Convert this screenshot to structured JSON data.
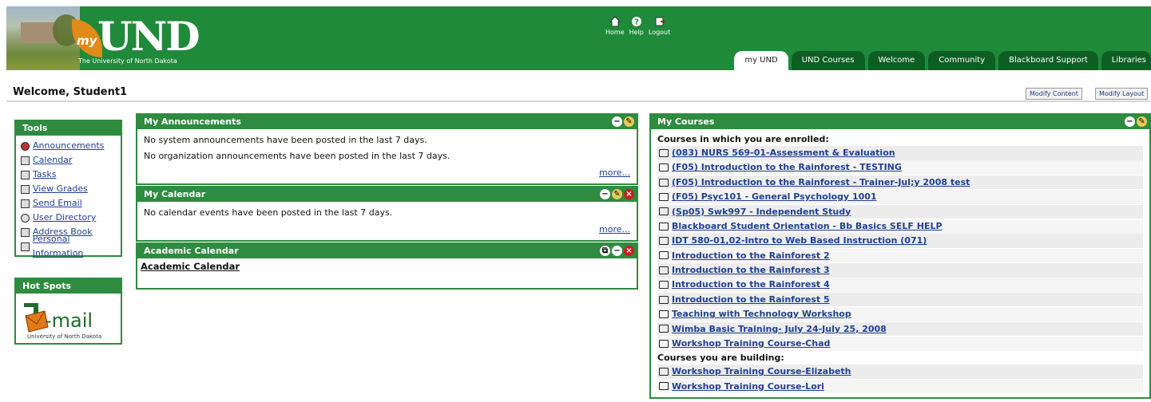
{
  "header": {
    "logo_text": "myUND",
    "logo_tagline": "The University of North Dakota",
    "topnav": [
      {
        "label": "Home",
        "icon": "home-icon"
      },
      {
        "label": "Help",
        "icon": "help-icon"
      },
      {
        "label": "Logout",
        "icon": "logout-icon"
      }
    ],
    "tabs": [
      "my UND",
      "UND Courses",
      "Welcome",
      "Community",
      "Blackboard Support",
      "Libraries"
    ],
    "active_tab": "my UND"
  },
  "welcome": {
    "text": "Welcome, Student1",
    "modify_content": "Modify Content",
    "modify_layout": "Modify Layout"
  },
  "tools": {
    "title": "Tools",
    "items": [
      {
        "label": "Announcements",
        "icon": "announcements-icon"
      },
      {
        "label": "Calendar",
        "icon": "calendar-icon"
      },
      {
        "label": "Tasks",
        "icon": "tasks-icon"
      },
      {
        "label": "View Grades",
        "icon": "grades-icon"
      },
      {
        "label": "Send Email",
        "icon": "email-icon"
      },
      {
        "label": "User Directory",
        "icon": "user-directory-icon"
      },
      {
        "label": "Address Book",
        "icon": "address-book-icon"
      },
      {
        "label": "Personal Information",
        "icon": "personal-info-icon"
      }
    ]
  },
  "hotspots": {
    "title": "Hot Spots",
    "umail_text": "-mail",
    "umail_sub": "University of North Dakota"
  },
  "announcements": {
    "title": "My Announcements",
    "lines": [
      "No system announcements have been posted in the last 7 days.",
      "No organization announcements have been posted in the last 7 days."
    ],
    "more": "more..."
  },
  "calendar": {
    "title": "My Calendar",
    "line": "No calendar events have been posted in the last 7 days.",
    "more": "more..."
  },
  "academic": {
    "title": "Academic Calendar",
    "link": "Academic Calendar"
  },
  "courses": {
    "title": "My Courses",
    "enrolled_heading": "Courses in which you are enrolled:",
    "enrolled": [
      "(083) NURS 569-01-Assessment & Evaluation",
      "(F05) Introduction to the Rainforest - TESTING",
      "(F05) Introduction to the Rainforest - Trainer-Jul;y 2008 test",
      "(F05) Psyc101 - General Psychology 1001",
      "(Sp05) Swk997 - Independent Study",
      "Blackboard Student Orientation - Bb Basics SELF HELP",
      "IDT 580-01,02-Intro to Web Based Instruction (071)",
      "Introduction to the Rainforest 2",
      "Introduction to the Rainforest 3",
      "Introduction to the Rainforest 4",
      "Introduction to the Rainforest 5",
      "Teaching with Technology Workshop",
      "Wimba Basic Training- July 24-July 25, 2008",
      "Workshop Training Course-Chad"
    ],
    "building_heading": "Courses you are building:",
    "building": [
      "Workshop Training Course-Elizabeth",
      "Workshop Training Course-Lori"
    ]
  }
}
